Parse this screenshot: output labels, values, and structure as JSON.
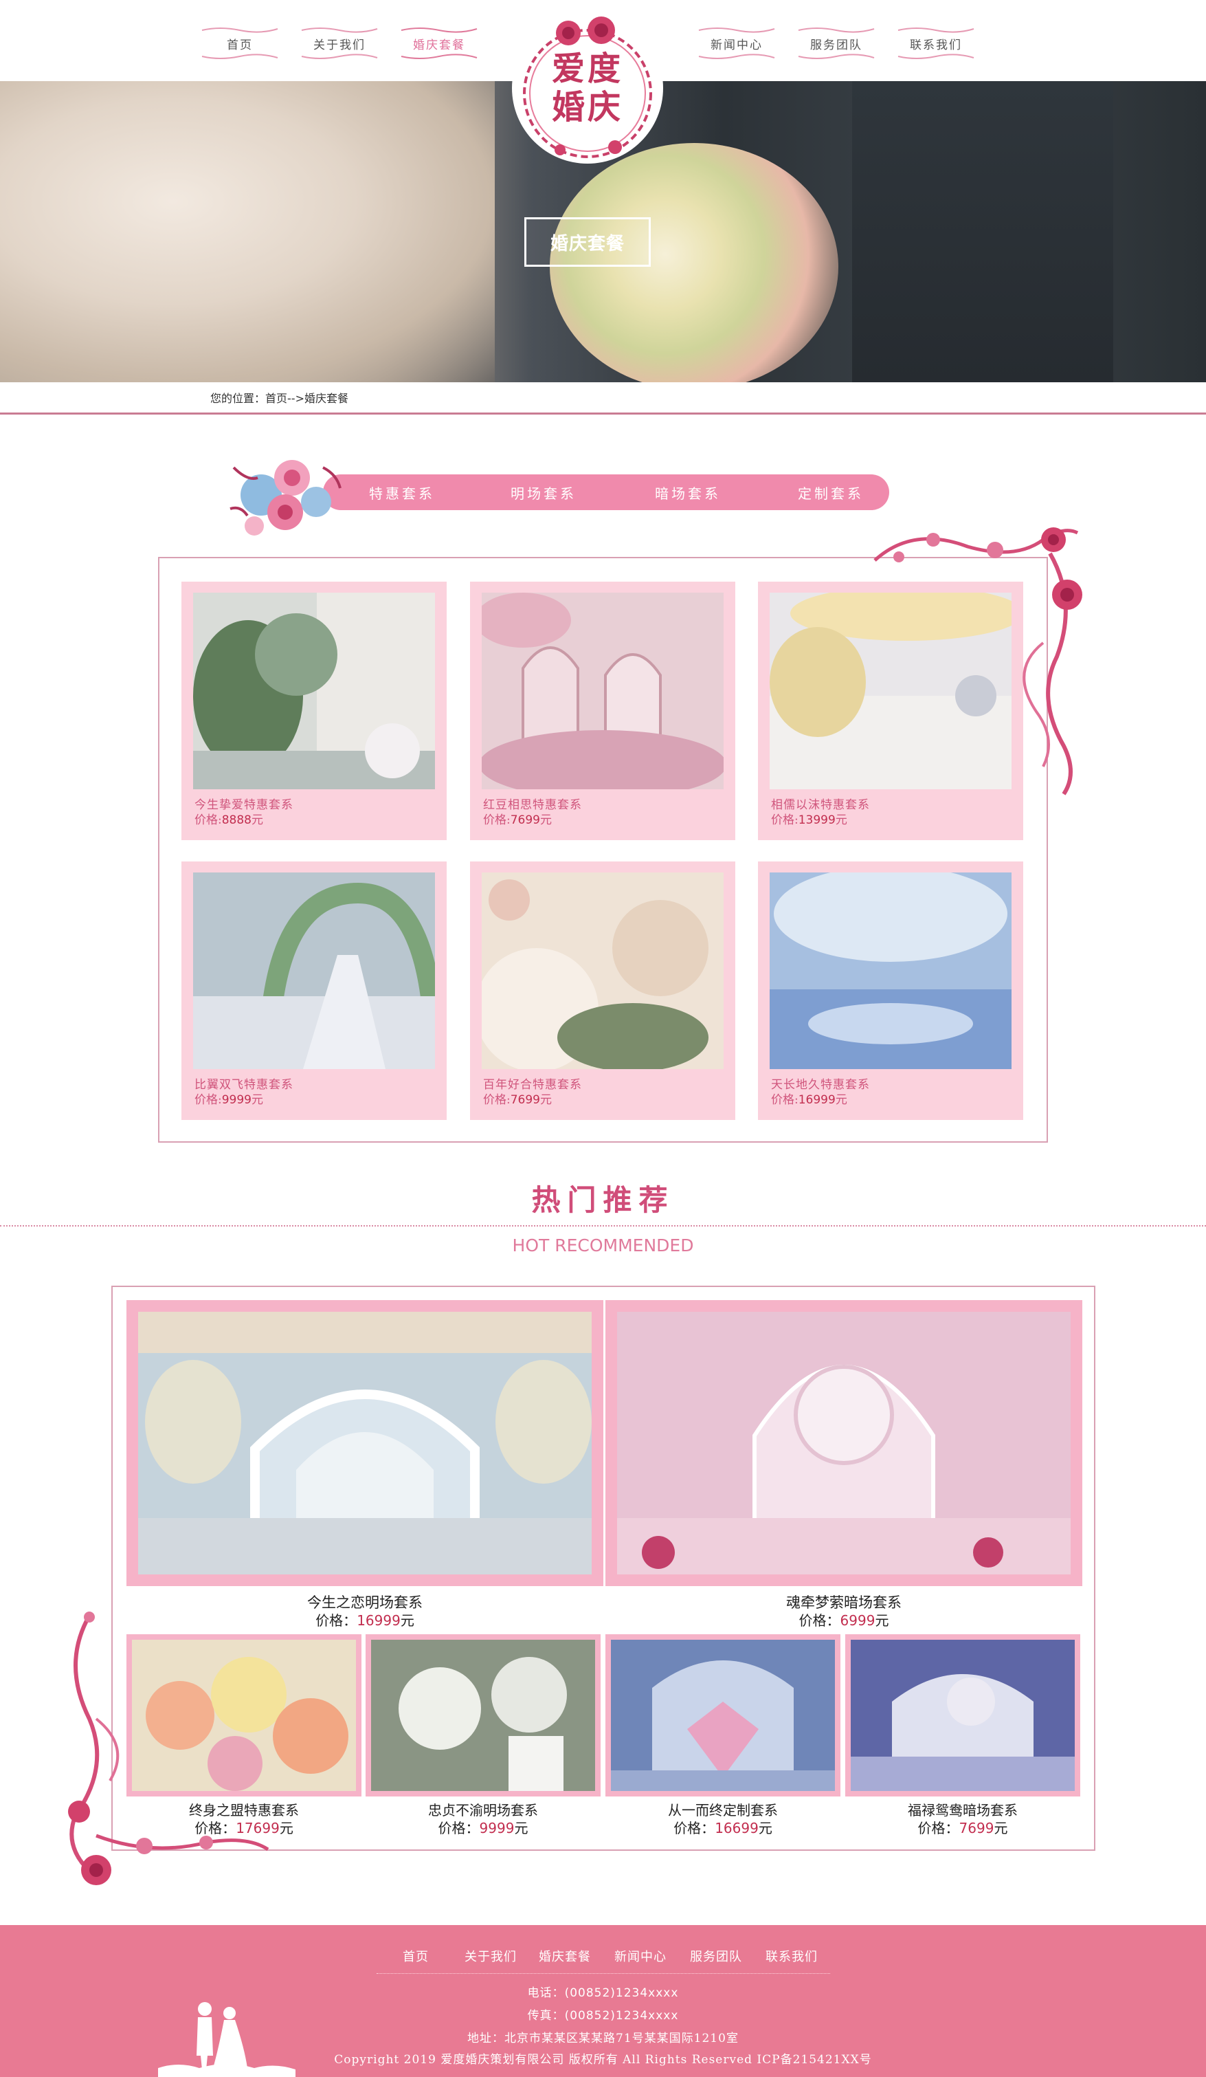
{
  "header": {
    "nav_left": [
      {
        "label": "首页"
      },
      {
        "label": "关于我们"
      },
      {
        "label": "婚庆套餐",
        "active": true
      }
    ],
    "nav_right": [
      {
        "label": "新闻中心"
      },
      {
        "label": "服务团队"
      },
      {
        "label": "联系我们"
      }
    ],
    "logo_text": "爱度婚庆"
  },
  "banner": {
    "button_label": "婚庆套餐"
  },
  "breadcrumb": {
    "prefix": "您的位置：",
    "home": "首页",
    "separator": "-->",
    "current": "婚庆套餐"
  },
  "categories": [
    "特惠套系",
    "明场套系",
    "暗场套系",
    "定制套系"
  ],
  "packages": [
    {
      "name": "今生挚爱特惠套系",
      "price_label": "价格:",
      "price": "8888",
      "unit": "元",
      "photo": "garden-ceremony"
    },
    {
      "name": "红豆相思特惠套系",
      "price_label": "价格:",
      "price": "7699",
      "unit": "元",
      "photo": "pink-arches"
    },
    {
      "name": "相儒以沫特惠套系",
      "price_label": "价格:",
      "price": "13999",
      "unit": "元",
      "photo": "banquet-hall"
    },
    {
      "name": "比翼双飞特惠套系",
      "price_label": "价格:",
      "price": "9999",
      "unit": "元",
      "photo": "floral-arch-aisle"
    },
    {
      "name": "百年好合特惠套系",
      "price_label": "价格:",
      "price": "7699",
      "unit": "元",
      "photo": "white-roses"
    },
    {
      "name": "天长地久特惠套系",
      "price_label": "价格:",
      "price": "16999",
      "unit": "元",
      "photo": "crystal-ceiling"
    }
  ],
  "hot": {
    "title": "热门推荐",
    "subtitle": "HOT RECOMMENDED",
    "featured": [
      {
        "name": "今生之恋明场套系",
        "price_label": "价格：",
        "price": "16999",
        "unit": "元",
        "photo": "blue-white-arch"
      },
      {
        "name": "魂牵梦萦暗场套系",
        "price_label": "价格：",
        "price": "6999",
        "unit": "元",
        "photo": "pink-gothic-window"
      }
    ],
    "items": [
      {
        "name": "终身之盟特惠套系",
        "price_label": "价格：",
        "price": "17699",
        "unit": "元",
        "photo": "lily-bouquet"
      },
      {
        "name": "忠贞不渝明场套系",
        "price_label": "价格：",
        "price": "9999",
        "unit": "元",
        "photo": "white-flowers"
      },
      {
        "name": "从一而终定制套系",
        "price_label": "价格：",
        "price": "16699",
        "unit": "元",
        "photo": "diamond-stage"
      },
      {
        "name": "福禄鸳鸯暗场套系",
        "price_label": "价格：",
        "price": "7699",
        "unit": "元",
        "photo": "purple-banquet"
      }
    ]
  },
  "footer": {
    "nav": [
      "首页",
      "关于我们",
      "婚庆套餐",
      "新闻中心",
      "服务团队",
      "联系我们"
    ],
    "phone_label": "电话：",
    "phone": "(00852)1234xxxx",
    "fax_label": "传真：",
    "fax": "(00852)1234xxxx",
    "address": "地址：北京市某某区某某路71号某某国际1210室",
    "copyright": "Copyright 2019 爱度婚庆策划有限公司 版权所有 All Rights Reserved ICP备215421XX号"
  },
  "colors": {
    "accent_pink": "#f08aac",
    "card_pink": "#fbd2dd",
    "footer_pink": "#e87a93",
    "price_red": "#c22e4f",
    "logo_red": "#c2375f"
  }
}
